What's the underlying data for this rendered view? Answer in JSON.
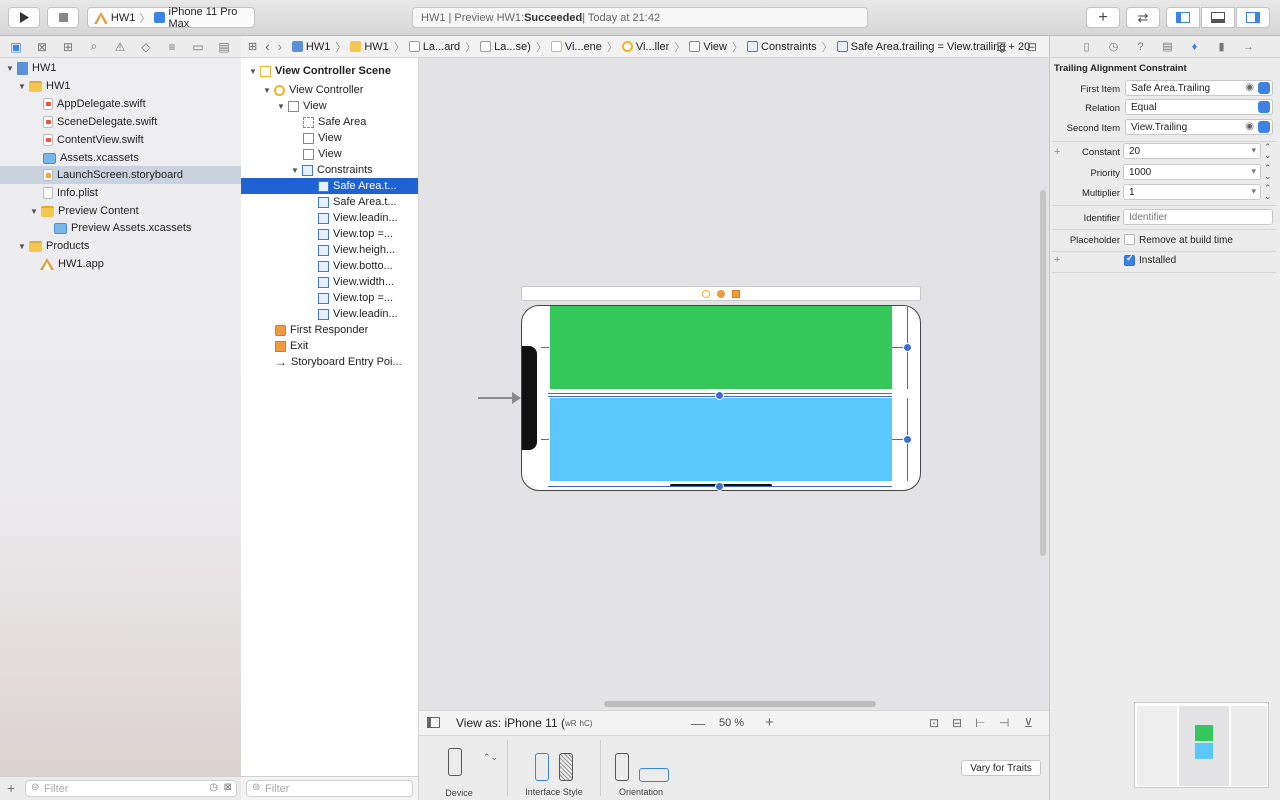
{
  "toolbar": {
    "scheme_target": "HW1",
    "scheme_device": "iPhone 11 Pro Max",
    "status_prefix": "HW1 | Preview HW1: ",
    "status_bold": "Succeeded",
    "status_suffix": " | Today at 21:42"
  },
  "navigator": {
    "rows": [
      {
        "label": "HW1",
        "icon": "project-icon"
      },
      {
        "label": "HW1",
        "icon": "folder-icon"
      },
      {
        "label": "AppDelegate.swift",
        "icon": "swift-file-icon"
      },
      {
        "label": "SceneDelegate.swift",
        "icon": "swift-file-icon"
      },
      {
        "label": "ContentView.swift",
        "icon": "swift-file-icon"
      },
      {
        "label": "Assets.xcassets",
        "icon": "assets-icon"
      },
      {
        "label": "LaunchScreen.storyboard",
        "icon": "storyboard-icon"
      },
      {
        "label": "Info.plist",
        "icon": "plist-icon"
      },
      {
        "label": "Preview Content",
        "icon": "folder-icon"
      },
      {
        "label": "Preview Assets.xcassets",
        "icon": "assets-icon"
      },
      {
        "label": "Products",
        "icon": "folder-icon"
      },
      {
        "label": "HW1.app",
        "icon": "app-icon"
      }
    ],
    "filter_placeholder": "Filter"
  },
  "jumpbar": {
    "crumbs": [
      "HW1",
      "HW1",
      "La...ard",
      "La...se)",
      "Vi...ene",
      "Vi...ller",
      "View",
      "Constraints",
      "Safe Area.trailing = View.trailing + 20"
    ]
  },
  "outline": {
    "rows": [
      {
        "label": "View Controller Scene"
      },
      {
        "label": "View Controller"
      },
      {
        "label": "View"
      },
      {
        "label": "Safe Area"
      },
      {
        "label": "View"
      },
      {
        "label": "View"
      },
      {
        "label": "Constraints"
      },
      {
        "label": "Safe Area.t..."
      },
      {
        "label": "Safe Area.t..."
      },
      {
        "label": "View.leadin..."
      },
      {
        "label": "View.top =..."
      },
      {
        "label": "View.heigh..."
      },
      {
        "label": "View.botto..."
      },
      {
        "label": "View.width..."
      },
      {
        "label": "View.top =..."
      },
      {
        "label": "View.leadin..."
      },
      {
        "label": "First Responder"
      },
      {
        "label": "Exit"
      },
      {
        "label": "Storyboard Entry Poi..."
      }
    ],
    "filter_placeholder": "Filter"
  },
  "canvas_bar": {
    "view_as": "View as: iPhone 11 (",
    "size_w": "wR",
    "size_h": "hC)",
    "zoom": "50 %"
  },
  "device_bar": {
    "device_label": "Device",
    "interface_label": "Interface Style",
    "orientation_label": "Orientation",
    "vary_button": "Vary for Traits"
  },
  "inspector": {
    "title": "Trailing Alignment Constraint",
    "first_item_label": "First Item",
    "first_item_value": "Safe Area.Trailing",
    "relation_label": "Relation",
    "relation_value": "Equal",
    "second_item_label": "Second Item",
    "second_item_value": "View.Trailing",
    "constant_label": "Constant",
    "constant_value": "20",
    "priority_label": "Priority",
    "priority_value": "1000",
    "multiplier_label": "Multiplier",
    "multiplier_value": "1",
    "identifier_label": "Identifier",
    "identifier_placeholder": "Identifier",
    "placeholder_label": "Placeholder",
    "remove_label": "Remove at build time",
    "installed_label": "Installed"
  },
  "colors": {
    "green_view": "#34c759",
    "blue_view": "#5ac8fa",
    "selection": "#1f63d3",
    "accent": "#3e82e4"
  }
}
